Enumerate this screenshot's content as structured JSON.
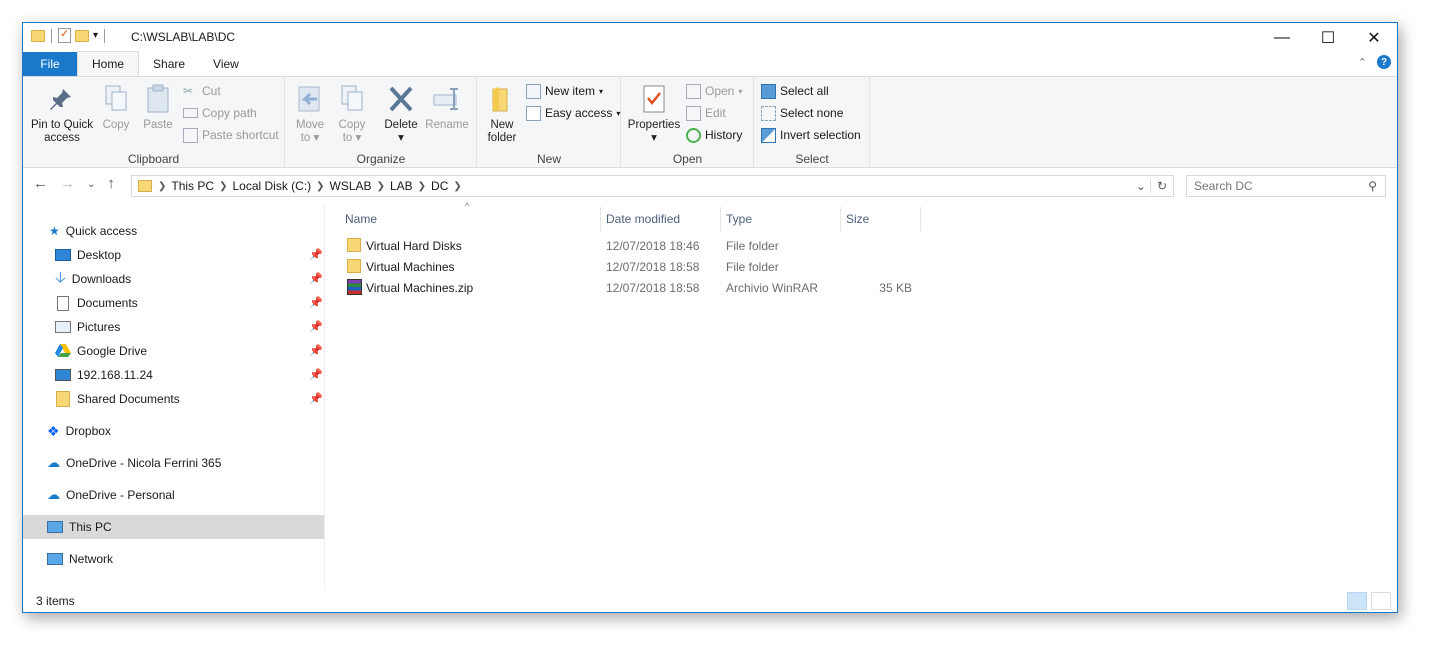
{
  "window": {
    "title": "C:\\WSLAB\\LAB\\DC"
  },
  "tabs": [
    {
      "label": "File"
    },
    {
      "label": "Home"
    },
    {
      "label": "Share"
    },
    {
      "label": "View"
    }
  ],
  "ribbon": {
    "clipboard": {
      "label": "Clipboard",
      "pin_label_1": "Pin to Quick",
      "pin_label_2": "access",
      "copy": "Copy",
      "paste": "Paste",
      "cut": "Cut",
      "copy_path": "Copy path",
      "paste_shortcut": "Paste shortcut"
    },
    "organize": {
      "label": "Organize",
      "move_1": "Move",
      "move_2": "to",
      "copyto_1": "Copy",
      "copyto_2": "to",
      "delete": "Delete",
      "rename": "Rename"
    },
    "new": {
      "label": "New",
      "new_folder_1": "New",
      "new_folder_2": "folder",
      "new_item": "New item",
      "easy_access": "Easy access"
    },
    "open": {
      "label": "Open",
      "properties": "Properties",
      "open": "Open",
      "edit": "Edit",
      "history": "History"
    },
    "select": {
      "label": "Select",
      "select_all": "Select all",
      "select_none": "Select none",
      "invert": "Invert selection"
    }
  },
  "address": {
    "crumbs": [
      "This PC",
      "Local Disk (C:)",
      "WSLAB",
      "LAB",
      "DC"
    ],
    "search_placeholder": "Search DC"
  },
  "nav_pane": {
    "quick_access": "Quick access",
    "pinned": [
      "Desktop",
      "Downloads",
      "Documents",
      "Pictures",
      "Google Drive",
      "192.168.11.24",
      "Shared Documents"
    ],
    "dropbox": "Dropbox",
    "onedrive_business": "OneDrive - Nicola Ferrini 365",
    "onedrive_personal": "OneDrive - Personal",
    "this_pc": "This PC",
    "network": "Network"
  },
  "file_list": {
    "columns": [
      "Name",
      "Date modified",
      "Type",
      "Size"
    ],
    "rows": [
      {
        "name": "Virtual Hard Disks",
        "date": "12/07/2018 18:46",
        "type": "File folder",
        "size": ""
      },
      {
        "name": "Virtual Machines",
        "date": "12/07/2018 18:58",
        "type": "File folder",
        "size": ""
      },
      {
        "name": "Virtual Machines.zip",
        "date": "12/07/2018 18:58",
        "type": "Archivio WinRAR",
        "size": "35 KB"
      }
    ]
  },
  "status": {
    "count": "3 items"
  },
  "colors": {
    "accent": "#1979ca",
    "folder": "#f8d775",
    "selected_nav": "#d9d9d9"
  }
}
